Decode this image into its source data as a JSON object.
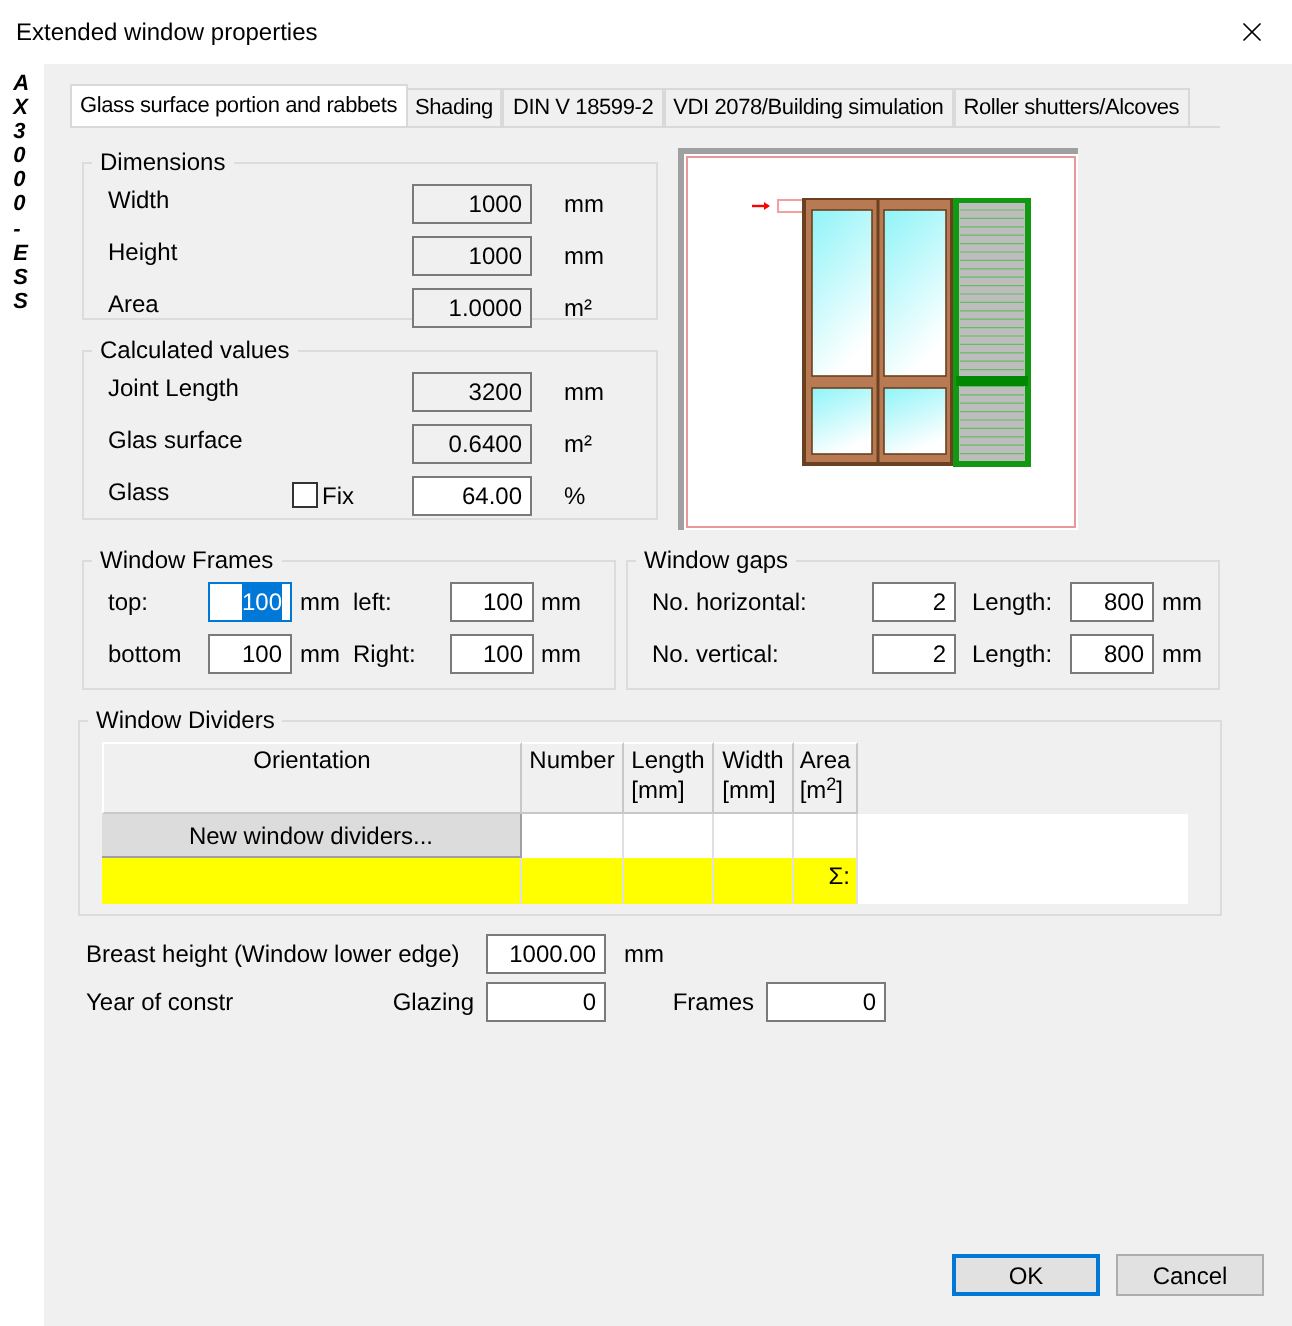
{
  "window": {
    "title": "Extended window properties"
  },
  "side_label": "AX3000 - ESS",
  "tabs": [
    {
      "label": "Glass surface portion and rabbets",
      "selected": true
    },
    {
      "label": "Shading",
      "selected": false
    },
    {
      "label": "DIN V 18599-2",
      "selected": false
    },
    {
      "label": "VDI 2078/Building simulation",
      "selected": false
    },
    {
      "label": "Roller shutters/Alcoves",
      "selected": false
    }
  ],
  "dimensions": {
    "title": "Dimensions",
    "rows": [
      {
        "label": "Width",
        "value": "1000",
        "unit": "mm",
        "disabled": true
      },
      {
        "label": "Height",
        "value": "1000",
        "unit": "mm",
        "disabled": true
      },
      {
        "label": "Area",
        "value": "1.0000",
        "unit": "m²",
        "disabled": true
      }
    ]
  },
  "calculated_values": {
    "title": "Calculated values",
    "rows": [
      {
        "label": "Joint Length",
        "value": "3200",
        "unit": "mm",
        "disabled": true
      },
      {
        "label": "Glas surface",
        "value": "0.6400",
        "unit": "m²",
        "disabled": true
      },
      {
        "label": "Glass",
        "value": "64.00",
        "unit": "%",
        "disabled": false,
        "checkbox": {
          "label": "Fix",
          "checked": false
        }
      }
    ]
  },
  "window_frames": {
    "title": "Window Frames",
    "fields": [
      {
        "label": "top:",
        "value": "100",
        "unit": "mm",
        "focused": true
      },
      {
        "label": "left:",
        "value": "100",
        "unit": "mm",
        "focused": false
      },
      {
        "label": "bottom",
        "value": "100",
        "unit": "mm",
        "focused": false
      },
      {
        "label": "Right:",
        "value": "100",
        "unit": "mm",
        "focused": false
      }
    ]
  },
  "window_gaps": {
    "title": "Window gaps",
    "rows": [
      {
        "label": "No. horizontal:",
        "count": "2",
        "length_label": "Length:",
        "length": "800",
        "unit": "mm"
      },
      {
        "label": "No. vertical:",
        "count": "2",
        "length_label": "Length:",
        "length": "800",
        "unit": "mm"
      }
    ]
  },
  "window_dividers": {
    "title": "Window Dividers",
    "columns": [
      {
        "label": "Orientation"
      },
      {
        "label": "Number"
      },
      {
        "label": "Length",
        "unit": "[mm]"
      },
      {
        "label": "Width",
        "unit": "[mm]"
      },
      {
        "label": "Area",
        "unit": "[m$^{2}$]"
      }
    ],
    "new_button": "New window dividers...",
    "sum_label": "Σ:"
  },
  "breast_height": {
    "label": "Breast height (Window lower edge)",
    "value": "1000.00",
    "unit": "mm"
  },
  "year_of_construction": {
    "label": "Year of constr",
    "fields": [
      {
        "label": "Glazing",
        "value": "0"
      },
      {
        "label": "Frames",
        "value": "0"
      }
    ]
  },
  "buttons": [
    {
      "label": "OK",
      "default": true
    },
    {
      "label": "Cancel",
      "default": false
    }
  ]
}
